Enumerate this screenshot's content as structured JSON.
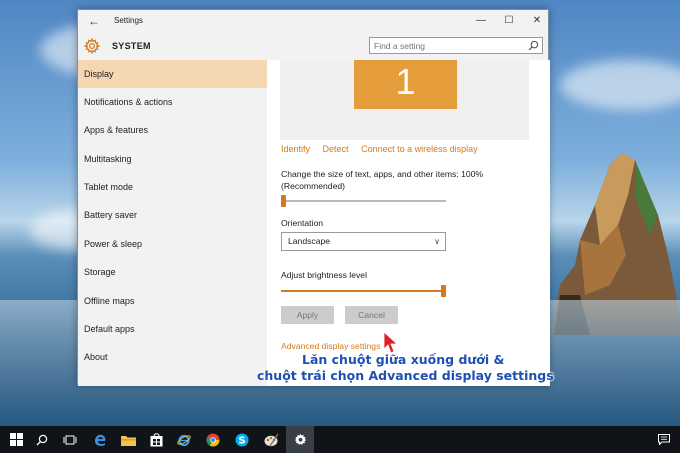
{
  "window": {
    "title": "Settings",
    "section": "SYSTEM",
    "search_placeholder": "Find a setting",
    "minimize_glyph": "—",
    "maximize_glyph": "☐",
    "close_glyph": "✕",
    "back_glyph": "←"
  },
  "sidebar": {
    "items": [
      {
        "label": "Display",
        "active": true
      },
      {
        "label": "Notifications & actions"
      },
      {
        "label": "Apps & features"
      },
      {
        "label": "Multitasking"
      },
      {
        "label": "Tablet mode"
      },
      {
        "label": "Battery saver"
      },
      {
        "label": "Power & sleep"
      },
      {
        "label": "Storage"
      },
      {
        "label": "Offline maps"
      },
      {
        "label": "Default apps"
      },
      {
        "label": "About"
      }
    ]
  },
  "display": {
    "monitor_number": "1",
    "links": {
      "identify": "Identify",
      "detect": "Detect",
      "wireless": "Connect to a wireless display"
    },
    "scale_label_line1": "Change the size of text, apps, and other items: 100%",
    "scale_label_line2": "(Recommended)",
    "scale_slider_fraction": 0.0,
    "orientation_label": "Orientation",
    "orientation_value": "Landscape",
    "brightness_label": "Adjust brightness level",
    "brightness_fraction": 1.0,
    "apply_label": "Apply",
    "cancel_label": "Cancel",
    "advanced_label": "Advanced display settings"
  },
  "annotation": {
    "line1": "Lăn chuột giữa xuống dưới &",
    "line2": "chuột trái chọn Advanced display settings",
    "color": "#1f4fb3"
  },
  "colors": {
    "accent": "#d57a1c",
    "monitor": "#e59c3a",
    "sidebar_active": "#f5d7b1"
  },
  "taskbar": {
    "icons": [
      "start-icon",
      "search-icon",
      "task-view-icon",
      "edge-icon",
      "file-explorer-icon",
      "store-icon",
      "internet-explorer-icon",
      "chrome-icon",
      "skype-icon",
      "paint-icon",
      "settings-icon"
    ],
    "tray_icons": [
      "notification-icon"
    ]
  }
}
